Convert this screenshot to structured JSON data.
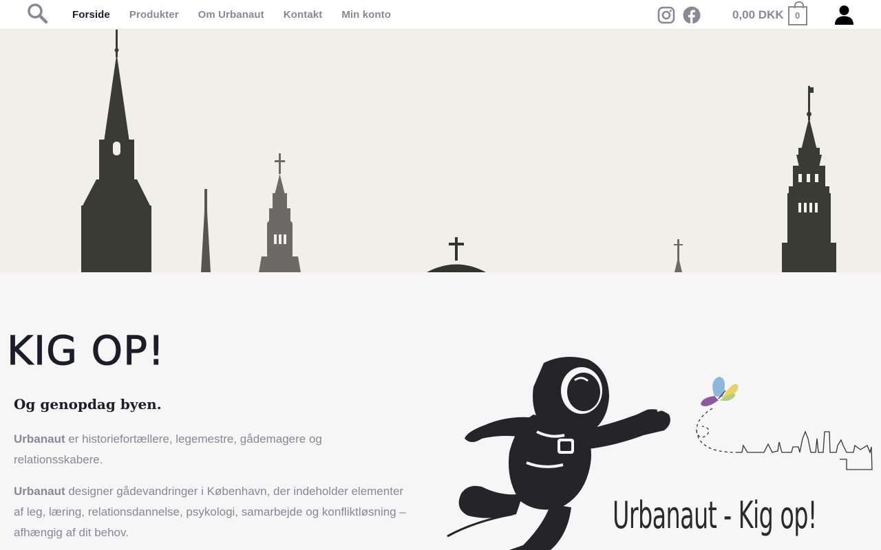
{
  "nav": {
    "items": [
      {
        "label": "Forside",
        "active": true
      },
      {
        "label": "Produkter",
        "active": false
      },
      {
        "label": "Om Urbanaut",
        "active": false
      },
      {
        "label": "Kontakt",
        "active": false
      },
      {
        "label": "Min konto",
        "active": false
      }
    ]
  },
  "icons": {
    "search": "search-icon",
    "instagram": "instagram-icon",
    "facebook": "facebook-icon",
    "cart": "cart-icon",
    "account": "user-icon"
  },
  "cart": {
    "total": "0,00 DKK",
    "count": "0"
  },
  "content": {
    "title": "KIG OP!",
    "subtitle": "Og genopdag byen.",
    "p1_brand": "Urbanaut",
    "p1_text": " er historiefortællere, legemestre, gådemagere og relationsskabere.",
    "p2_brand": "Urbanaut",
    "p2_text": " designer gådevandringer i København, der indeholder elementer af leg, læring, relationsdannelse, psykologi, samarbejde og konfliktløsning – afhængig af dit behov.",
    "tagline": "Urbanaut - Kig op!"
  },
  "colors": {
    "text_dark": "#1d1d29",
    "text_muted": "#8a8796",
    "hero_bg": "#f1efea",
    "page_bg": "#f6f6f6"
  }
}
